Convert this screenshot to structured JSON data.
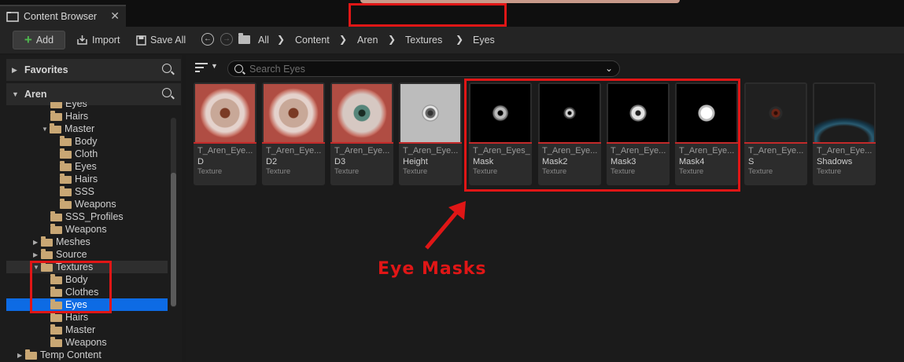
{
  "tab": {
    "title": "Content Browser",
    "close": "✕"
  },
  "toolbar": {
    "add": "Add",
    "import": "Import",
    "save_all": "Save All"
  },
  "breadcrumb": [
    "All",
    "Content",
    "Aren",
    "Textures",
    "Eyes"
  ],
  "left": {
    "favorites": "Favorites",
    "project": "Aren",
    "tree": [
      {
        "label": "Eyes"
      },
      {
        "label": "Hairs"
      },
      {
        "label": "Master"
      },
      {
        "label": "Body"
      },
      {
        "label": "Cloth"
      },
      {
        "label": "Eyes"
      },
      {
        "label": "Hairs"
      },
      {
        "label": "SSS"
      },
      {
        "label": "Weapons"
      },
      {
        "label": "SSS_Profiles"
      },
      {
        "label": "Weapons"
      },
      {
        "label": "Meshes"
      },
      {
        "label": "Source"
      },
      {
        "label": "Textures"
      },
      {
        "label": "Body"
      },
      {
        "label": "Clothes"
      },
      {
        "label": "Eyes"
      },
      {
        "label": "Hairs"
      },
      {
        "label": "Master"
      },
      {
        "label": "Weapons"
      },
      {
        "label": "Temp Content"
      }
    ]
  },
  "search": {
    "placeholder": "Search Eyes"
  },
  "assets": [
    {
      "name": "T_Aren_Eye...",
      "suffix": "D",
      "type": "Texture"
    },
    {
      "name": "T_Aren_Eye...",
      "suffix": "D2",
      "type": "Texture"
    },
    {
      "name": "T_Aren_Eye...",
      "suffix": "D3",
      "type": "Texture"
    },
    {
      "name": "T_Aren_Eye...",
      "suffix": "Height",
      "type": "Texture"
    },
    {
      "name": "T_Aren_Eyes_",
      "suffix": "Mask",
      "type": "Texture"
    },
    {
      "name": "T_Aren_Eye...",
      "suffix": "Mask2",
      "type": "Texture"
    },
    {
      "name": "T_Aren_Eye...",
      "suffix": "Mask3",
      "type": "Texture"
    },
    {
      "name": "T_Aren_Eye...",
      "suffix": "Mask4",
      "type": "Texture"
    },
    {
      "name": "T_Aren_Eye...",
      "suffix": "S",
      "type": "Texture"
    },
    {
      "name": "T_Aren_Eye...",
      "suffix": "Shadows",
      "type": "Texture"
    }
  ],
  "annotation": "Eye Masks",
  "colors": {
    "annotation": "#e01616",
    "selection": "#0d6be4",
    "folder": "#c9a774"
  }
}
